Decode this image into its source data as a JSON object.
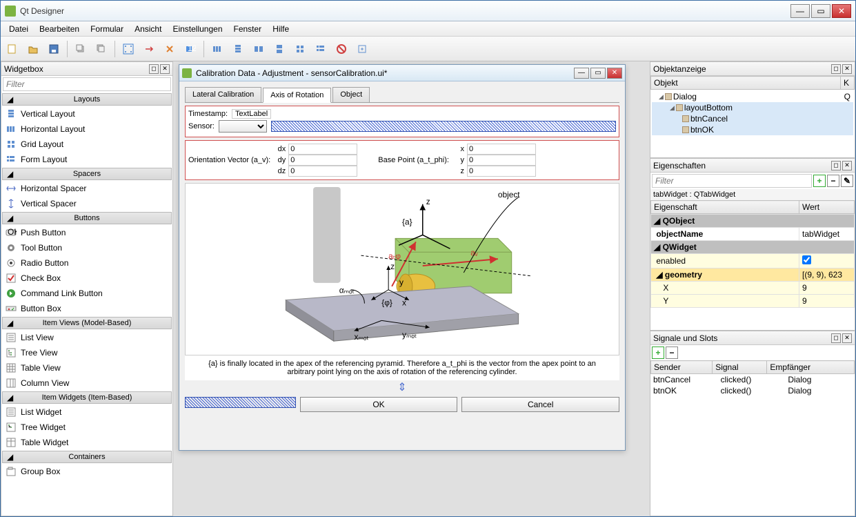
{
  "window": {
    "title": "Qt Designer"
  },
  "menubar": [
    "Datei",
    "Bearbeiten",
    "Formular",
    "Ansicht",
    "Einstellungen",
    "Fenster",
    "Hilfe"
  ],
  "widgetbox": {
    "title": "Widgetbox",
    "filter_placeholder": "Filter",
    "sections": [
      {
        "header": "Layouts",
        "items": [
          "Vertical Layout",
          "Horizontal Layout",
          "Grid Layout",
          "Form Layout"
        ]
      },
      {
        "header": "Spacers",
        "items": [
          "Horizontal Spacer",
          "Vertical Spacer"
        ]
      },
      {
        "header": "Buttons",
        "items": [
          "Push Button",
          "Tool Button",
          "Radio Button",
          "Check Box",
          "Command Link Button",
          "Button Box"
        ]
      },
      {
        "header": "Item Views (Model-Based)",
        "items": [
          "List View",
          "Tree View",
          "Table View",
          "Column View"
        ]
      },
      {
        "header": "Item Widgets (Item-Based)",
        "items": [
          "List Widget",
          "Tree Widget",
          "Table Widget"
        ]
      },
      {
        "header": "Containers",
        "items": [
          "Group Box"
        ]
      }
    ]
  },
  "designer_form": {
    "title": "Calibration Data - Adjustment - sensorCalibration.ui*",
    "tabs": [
      "Lateral Calibration",
      "Axis of Rotation",
      "Object"
    ],
    "active_tab": 1,
    "timestamp_label": "Timestamp:",
    "timestamp_value": "TextLabel",
    "sensor_label": "Sensor:",
    "orientation_label": "Orientation Vector (a_v):",
    "basepoint_label": "Base Point (a_t_phi):",
    "orientation": {
      "dx": "0",
      "dy": "0",
      "dz": "0"
    },
    "basepoint": {
      "x": "0",
      "y": "0",
      "z": "0"
    },
    "description": "{a} is finally located in the apex of the referencing pyramid. Therefore a_t_phi is the vector from the apex point to an arbitrary point lying on the axis of rotation of the referencing cylinder.",
    "diagram_labels": {
      "object": "object",
      "z": "z",
      "a": "{a}",
      "atphi": "aₜφ",
      "av": "aᵥ",
      "phi": "{φ}",
      "y": "y",
      "x": "x",
      "xmot": "xₘₒₜ",
      "ymot": "yₘₒₜ",
      "alphamot": "αₘₒₜ"
    },
    "ok": "OK",
    "cancel": "Cancel"
  },
  "object_panel": {
    "title": "Objektanzeige",
    "header_obj": "Objekt",
    "header_k": "K",
    "items": [
      {
        "indent": 0,
        "name": "Dialog",
        "k": "Q"
      },
      {
        "indent": 1,
        "name": "layoutBottom",
        "k": ""
      },
      {
        "indent": 2,
        "name": "btnCancel",
        "k": ""
      },
      {
        "indent": 2,
        "name": "btnOK",
        "k": ""
      }
    ]
  },
  "prop_panel": {
    "title": "Eigenschaften",
    "filter_placeholder": "Filter",
    "class_label": "tabWidget : QTabWidget",
    "header_prop": "Eigenschaft",
    "header_val": "Wert",
    "rows": [
      {
        "type": "group",
        "name": "QObject"
      },
      {
        "type": "prop",
        "name": "objectName",
        "val": "tabWidget",
        "bold": true
      },
      {
        "type": "group",
        "name": "QWidget"
      },
      {
        "type": "prop",
        "name": "enabled",
        "val": "checkbox",
        "yellow": true
      },
      {
        "type": "prop",
        "name": "geometry",
        "val": "[(9, 9), 623",
        "yellow": true,
        "sel": true,
        "bold": true
      },
      {
        "type": "sub",
        "name": "X",
        "val": "9",
        "yellow": true
      },
      {
        "type": "sub",
        "name": "Y",
        "val": "9",
        "yellow": true
      }
    ]
  },
  "signal_panel": {
    "title": "Signale und Slots",
    "header_sender": "Sender",
    "header_signal": "Signal",
    "header_recv": "Empfänger",
    "rows": [
      {
        "sender": "btnCancel",
        "signal": "clicked()",
        "recv": "Dialog"
      },
      {
        "sender": "btnOK",
        "signal": "clicked()",
        "recv": "Dialog"
      }
    ]
  }
}
